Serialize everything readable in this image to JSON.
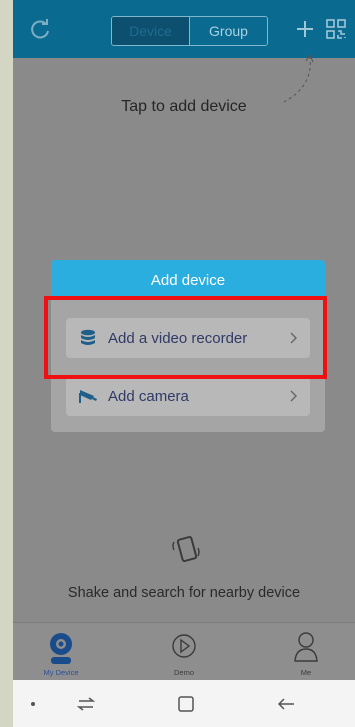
{
  "header": {
    "tabs": [
      {
        "label": "Device",
        "selected": true
      },
      {
        "label": "Group",
        "selected": false
      }
    ],
    "refresh_icon": "refresh-icon",
    "add_icon": "plus-icon",
    "qr_icon": "qr-code-icon"
  },
  "main": {
    "hint": "Tap to add device",
    "shake_text": "Shake and search for nearby device"
  },
  "dialog": {
    "title": "Add device",
    "options": [
      {
        "label": "Add a video recorder",
        "icon": "database-icon"
      },
      {
        "label": "Add camera",
        "icon": "camera-icon"
      }
    ]
  },
  "tabbar": {
    "items": [
      {
        "label": "My Device",
        "icon": "webcam-icon",
        "active": true
      },
      {
        "label": "Demo",
        "icon": "play-circle-icon",
        "active": false
      },
      {
        "label": "Me",
        "icon": "user-icon",
        "active": false
      }
    ]
  },
  "colors": {
    "header": "#0a6a8f",
    "accent": "#2aaee0",
    "highlight": "#ef1111"
  }
}
